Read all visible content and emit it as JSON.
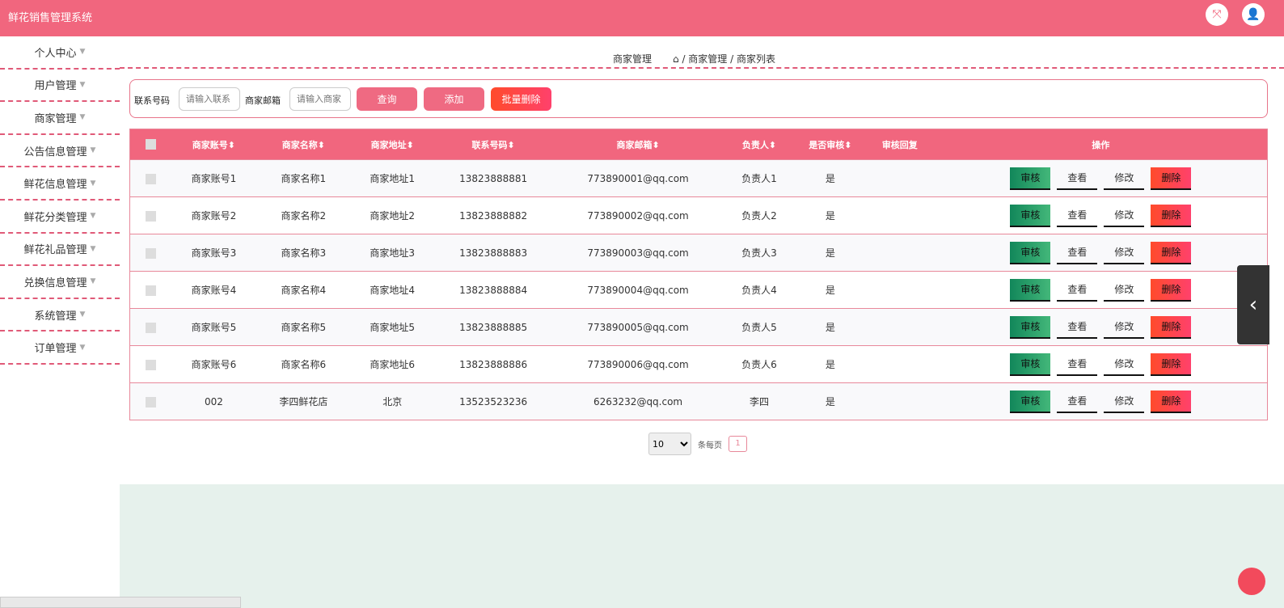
{
  "header": {
    "title": "鲜花销售管理系统",
    "fullscreen_icon": "expand-icon",
    "user_icon": "user-icon"
  },
  "sidebar": {
    "items": [
      {
        "label": "个人中心"
      },
      {
        "label": "用户管理"
      },
      {
        "label": "商家管理"
      },
      {
        "label": "公告信息管理"
      },
      {
        "label": "鲜花信息管理"
      },
      {
        "label": "鲜花分类管理"
      },
      {
        "label": "鲜花礼品管理"
      },
      {
        "label": "兑换信息管理"
      },
      {
        "label": "系统管理"
      },
      {
        "label": "订单管理"
      }
    ]
  },
  "breadcrumb": {
    "title": "商家管理",
    "path": "/ 商家管理 / 商家列表"
  },
  "search": {
    "phone_label": "联系号码",
    "phone_placeholder": "请输入联系",
    "email_label": "商家邮箱",
    "email_placeholder": "请输入商家",
    "query": "查询",
    "add": "添加",
    "batch_delete": "批量删除"
  },
  "colors": {
    "primary": "#f1667e",
    "audit": "#12875a",
    "delete": "#ff4b2b"
  },
  "table": {
    "headers": [
      "商家账号",
      "商家名称",
      "商家地址",
      "联系号码",
      "商家邮箱",
      "负责人",
      "是否审核",
      "审核回复",
      "操作"
    ],
    "sort_mark": "⬍",
    "actions": {
      "audit": "审核",
      "view": "查看",
      "edit": "修改",
      "delete": "删除"
    },
    "rows": [
      [
        "商家账号1",
        "商家名称1",
        "商家地址1",
        "13823888881",
        "773890001@qq.com",
        "负责人1",
        "是",
        ""
      ],
      [
        "商家账号2",
        "商家名称2",
        "商家地址2",
        "13823888882",
        "773890002@qq.com",
        "负责人2",
        "是",
        ""
      ],
      [
        "商家账号3",
        "商家名称3",
        "商家地址3",
        "13823888883",
        "773890003@qq.com",
        "负责人3",
        "是",
        ""
      ],
      [
        "商家账号4",
        "商家名称4",
        "商家地址4",
        "13823888884",
        "773890004@qq.com",
        "负责人4",
        "是",
        ""
      ],
      [
        "商家账号5",
        "商家名称5",
        "商家地址5",
        "13823888885",
        "773890005@qq.com",
        "负责人5",
        "是",
        ""
      ],
      [
        "商家账号6",
        "商家名称6",
        "商家地址6",
        "13823888886",
        "773890006@qq.com",
        "负责人6",
        "是",
        ""
      ],
      [
        "002",
        "李四鲜花店",
        "北京",
        "13523523236",
        "6263232@qq.com",
        "李四",
        "是",
        ""
      ]
    ]
  },
  "pager": {
    "page_size": "10",
    "per_page_label": "条每页",
    "current_page": "1"
  }
}
